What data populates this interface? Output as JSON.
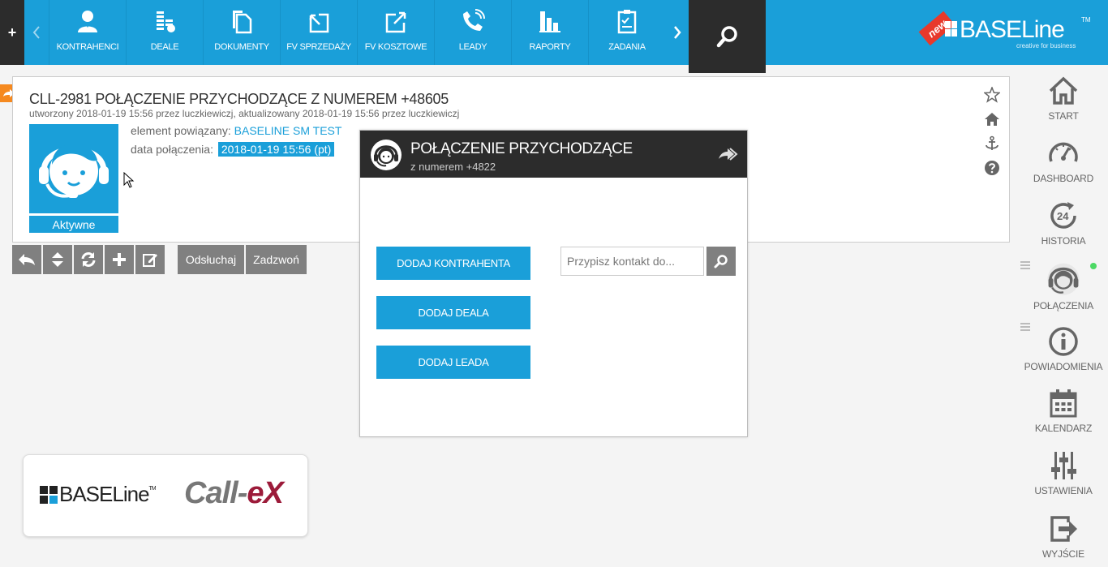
{
  "topbar": {
    "plus_label": "+",
    "nav_items": [
      {
        "label": "KONTRAHENCI",
        "icon": "person-icon"
      },
      {
        "label": "DEALE",
        "icon": "coins-icon"
      },
      {
        "label": "DOKUMENTY",
        "icon": "documents-icon"
      },
      {
        "label": "FV SPRZEDAŻY",
        "icon": "invoice-out-icon"
      },
      {
        "label": "FV KOSZTOWE",
        "icon": "invoice-in-icon"
      },
      {
        "label": "LEADY",
        "icon": "phone-icon"
      },
      {
        "label": "RAPORTY",
        "icon": "bar-chart-icon"
      },
      {
        "label": "ZADANIA",
        "icon": "clipboard-icon"
      }
    ],
    "logo_text": "BASELine",
    "logo_tm": "TM",
    "logo_tagline": "creative for business",
    "new_badge": "new"
  },
  "call": {
    "title": "CLL-2981  POŁĄCZENIE PRZYCHODZĄCE Z NUMEREM +48605",
    "meta": "utworzony 2018-01-19 15:56 przez luczkiewiczj, aktualizowany 2018-01-19 15:56 przez luczkiewiczj",
    "related_label": "element powiązany: ",
    "related_value": "BASELINE SM TEST",
    "date_label": "data połączenia: ",
    "date_value": "2018-01-19 15:56 (pt)",
    "status": "Aktywne"
  },
  "actions": {
    "listen_label": "Odsłuchaj",
    "call_label": "Zadzwoń"
  },
  "popup": {
    "title": "POŁĄCZENIE PRZYCHODZĄCE",
    "subtitle": "z numerem +4822",
    "add_contractor": "DODAJ KONTRAHENTA",
    "add_deal": "DODAJ DEALA",
    "add_lead": "DODAJ LEADA",
    "assign_placeholder": "Przypisz kontakt do..."
  },
  "sidebar": {
    "items": [
      {
        "label": "START",
        "icon": "home-icon"
      },
      {
        "label": "DASHBOARD",
        "icon": "gauge-icon"
      },
      {
        "label": "HISTORIA",
        "icon": "history-24-icon"
      },
      {
        "label": "POŁĄCZENIA",
        "icon": "headset-icon"
      },
      {
        "label": "POWIADOMIENIA",
        "icon": "info-icon"
      },
      {
        "label": "KALENDARZ",
        "icon": "calendar-icon"
      },
      {
        "label": "USTAWIENIA",
        "icon": "sliders-icon"
      },
      {
        "label": "WYJŚCIE",
        "icon": "exit-icon"
      }
    ]
  },
  "footer_logos": {
    "baseline": "BASELine",
    "baseline_tm": "TM",
    "callex_a": "Call-",
    "callex_b": "eX"
  },
  "colors": {
    "brand_blue": "#1a9fd9",
    "dark": "#2c2c2c",
    "button_gray": "#808080",
    "accent_orange": "#f5891f",
    "callex_red": "#9c1b3a",
    "online_green": "#4cd964"
  }
}
